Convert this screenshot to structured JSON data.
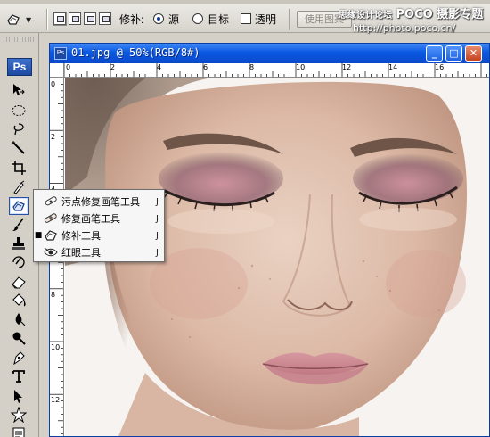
{
  "options_bar": {
    "patch_label": "修补:",
    "source_label": "源",
    "destination_label": "目标",
    "transparent_label": "透明",
    "use_pattern_label": "使用图案",
    "source_selected": true,
    "transparent_checked": false
  },
  "watermark": {
    "line1_prefix": "思缘设计论坛",
    "line1_brand": "POCO 摄影专题",
    "line2": "http://photo.poco.cn/"
  },
  "toolbox": {
    "logo": "Ps",
    "tools": [
      "move-icon",
      "marquee-icon",
      "lasso-icon",
      "magic-wand-icon",
      "crop-icon",
      "slice-icon",
      "healing-brush-icon",
      "brush-icon",
      "clone-stamp-icon",
      "history-brush-icon",
      "eraser-icon",
      "paint-bucket-icon",
      "blur-icon",
      "dodge-icon",
      "pen-icon",
      "type-icon",
      "path-selection-icon",
      "shape-icon",
      "notes-icon"
    ]
  },
  "flyout": {
    "items": [
      {
        "label": "污点修复画笔工具",
        "shortcut": "J",
        "icon": "spot-healing-brush-icon",
        "selected": false
      },
      {
        "label": "修复画笔工具",
        "shortcut": "J",
        "icon": "healing-brush-icon",
        "selected": false
      },
      {
        "label": "修补工具",
        "shortcut": "J",
        "icon": "patch-icon",
        "selected": true
      },
      {
        "label": "红眼工具",
        "shortcut": "J",
        "icon": "red-eye-icon",
        "selected": false
      }
    ]
  },
  "document": {
    "title": "01.jpg @ 50%(RGB/8#)",
    "ruler_top": [
      "0",
      "2",
      "4",
      "6",
      "8",
      "10",
      "12",
      "14",
      "16"
    ],
    "ruler_left": [
      "0",
      "2",
      "4",
      "6",
      "8",
      "10",
      "12"
    ]
  },
  "colors": {
    "titlebar": "#0a58e1",
    "selection_border": "#2a4fa0"
  }
}
